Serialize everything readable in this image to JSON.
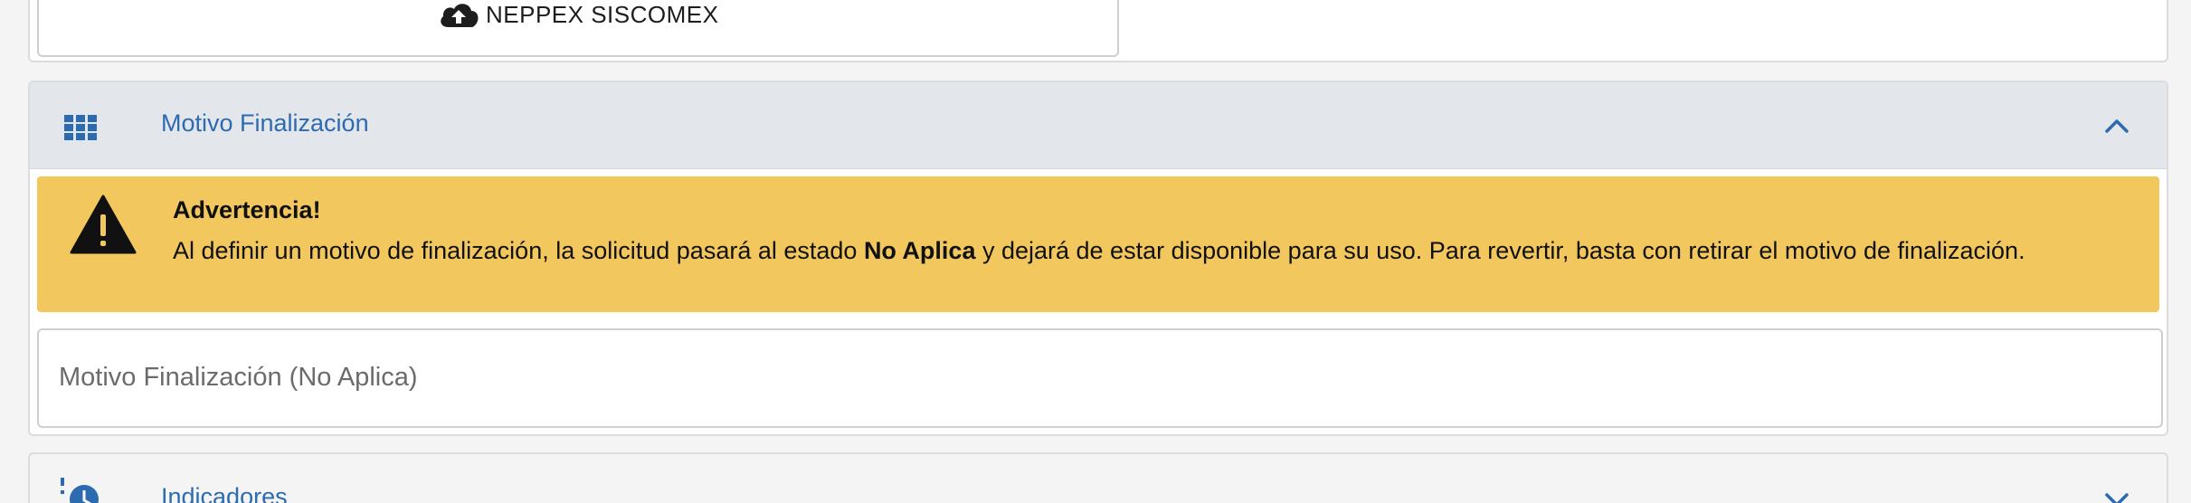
{
  "upload": {
    "label": "NEPPEX SISCOMEX",
    "icon": "cloud-upload-icon"
  },
  "motivo_panel": {
    "title": "Motivo Finalización",
    "header_icon": "grid-icon",
    "toggle_icon": "chevron-up-icon",
    "alert": {
      "icon": "warning-icon",
      "title": "Advertencia!",
      "text_before": "Al definir un motivo de finalización, la solicitud pasará al estado ",
      "text_bold": "No Aplica",
      "text_after": " y dejará de estar disponible para su uso. Para revertir, basta con retirar el motivo de finalización.",
      "color": "#f2c75e"
    },
    "field": {
      "label": "Motivo Finalización (No Aplica)",
      "value": ""
    }
  },
  "indicadores_panel": {
    "title": "Indicadores",
    "header_icon": "clock-history-icon",
    "toggle_icon": "chevron-down-icon"
  },
  "colors": {
    "accent": "#2d6bb0",
    "header_bg": "#e3e7ec",
    "page_bg": "#f4f4f4"
  }
}
